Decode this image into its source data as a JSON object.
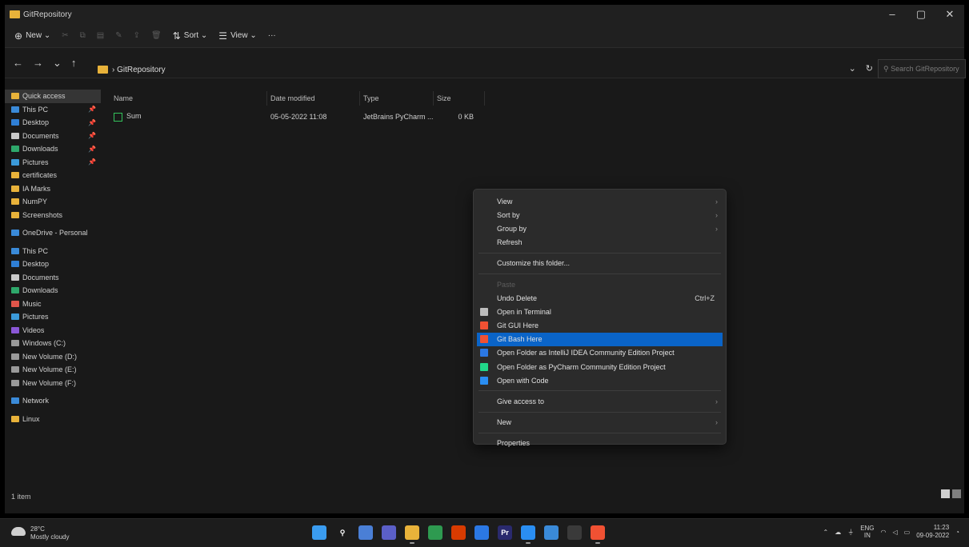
{
  "window": {
    "title": "GitRepository",
    "controls": [
      "–",
      "▢",
      "✕"
    ]
  },
  "commandbar": {
    "new_label": "New",
    "sort_label": "Sort",
    "view_label": "View",
    "more_label": "···"
  },
  "address": {
    "crumb": "GitRepository",
    "search_placeholder": "Search GitRepository"
  },
  "sidebar": {
    "items": [
      {
        "label": "Quick access",
        "color": "#e8b23a",
        "pinned": false,
        "active": true
      },
      {
        "label": "This PC",
        "color": "#3a8ad8",
        "pinned": true
      },
      {
        "label": "Desktop",
        "color": "#2f7fd6",
        "pinned": true
      },
      {
        "label": "Documents",
        "color": "#c9c9c9",
        "pinned": true
      },
      {
        "label": "Downloads",
        "color": "#2ea86b",
        "pinned": true
      },
      {
        "label": "Pictures",
        "color": "#3b9ad9",
        "pinned": true
      },
      {
        "label": "certificates",
        "color": "#e8b23a"
      },
      {
        "label": "IA Marks",
        "color": "#e8b23a"
      },
      {
        "label": "NumPY",
        "color": "#e8b23a"
      },
      {
        "label": "Screenshots",
        "color": "#e8b23a"
      },
      {
        "label": "OneDrive - Personal",
        "color": "#3a8ad8",
        "gap": true
      },
      {
        "label": "This PC",
        "color": "#3a8ad8",
        "gap": true
      },
      {
        "label": "Desktop",
        "color": "#2f7fd6"
      },
      {
        "label": "Documents",
        "color": "#c9c9c9"
      },
      {
        "label": "Downloads",
        "color": "#2ea86b"
      },
      {
        "label": "Music",
        "color": "#e0554a"
      },
      {
        "label": "Pictures",
        "color": "#3b9ad9"
      },
      {
        "label": "Videos",
        "color": "#8a57d6"
      },
      {
        "label": "Windows (C:)",
        "color": "#9a9a9a"
      },
      {
        "label": "New Volume (D:)",
        "color": "#9a9a9a"
      },
      {
        "label": "New Volume (E:)",
        "color": "#9a9a9a"
      },
      {
        "label": "New Volume (F:)",
        "color": "#9a9a9a"
      },
      {
        "label": "Network",
        "color": "#3a8ad8",
        "gap": true
      },
      {
        "label": "Linux",
        "color": "#e8b23a",
        "gap": true
      }
    ]
  },
  "file_list": {
    "columns": [
      "Name",
      "Date modified",
      "Type",
      "Size"
    ],
    "rows": [
      {
        "name": "Sum",
        "date": "05-05-2022 11:08",
        "type": "JetBrains PyCharm ...",
        "size": "0 KB"
      }
    ]
  },
  "status": {
    "count": "1 item"
  },
  "context_menu": {
    "items": [
      {
        "label": "View",
        "arrow": true
      },
      {
        "label": "Sort by",
        "arrow": true
      },
      {
        "label": "Group by",
        "arrow": true
      },
      {
        "label": "Refresh"
      },
      {
        "sep": true
      },
      {
        "label": "Customize this folder..."
      },
      {
        "sep": true
      },
      {
        "label": "Paste",
        "disabled": true
      },
      {
        "label": "Undo Delete",
        "shortcut": "Ctrl+Z"
      },
      {
        "label": "Open in Terminal",
        "icon_color": "#bdbdbd",
        "icon": "terminal-icon"
      },
      {
        "label": "Git GUI Here",
        "icon_color": "#f05133",
        "icon": "git-icon"
      },
      {
        "label": "Git Bash Here",
        "icon_color": "#f05133",
        "icon": "git-bash-icon",
        "highlight": true
      },
      {
        "label": "Open Folder as IntelliJ IDEA Community Edition Project",
        "icon_color": "#2b78e4",
        "icon": "intellij-icon"
      },
      {
        "label": "Open Folder as PyCharm Community Edition Project",
        "icon_color": "#21d789",
        "icon": "pycharm-icon"
      },
      {
        "label": "Open with Code",
        "icon_color": "#2a8ef2",
        "icon": "vscode-icon"
      },
      {
        "sep": true
      },
      {
        "label": "Give access to",
        "arrow": true
      },
      {
        "sep": true
      },
      {
        "label": "New",
        "arrow": true
      },
      {
        "sep": true
      },
      {
        "label": "Properties"
      }
    ]
  },
  "taskbar": {
    "weather_temp": "28°C",
    "weather_text": "Mostly cloudy",
    "apps": [
      {
        "name": "start-icon",
        "color": "#3a9cf0",
        "glyph": ""
      },
      {
        "name": "search-icon",
        "color": "transparent",
        "glyph": "⚲"
      },
      {
        "name": "task-view-icon",
        "color": "#4a7fd6",
        "glyph": ""
      },
      {
        "name": "chat-icon",
        "color": "#5b5fc7",
        "glyph": ""
      },
      {
        "name": "file-explorer-icon",
        "color": "#e8b23a",
        "glyph": "",
        "running": true
      },
      {
        "name": "chrome-icon",
        "color": "#2e9a50",
        "glyph": ""
      },
      {
        "name": "office-icon",
        "color": "#d83b01",
        "glyph": ""
      },
      {
        "name": "store-icon",
        "color": "#2b78e4",
        "glyph": ""
      },
      {
        "name": "premiere-icon",
        "color": "#2a2a6e",
        "glyph": "Pr"
      },
      {
        "name": "vscode-icon",
        "color": "#2a8ef2",
        "glyph": "",
        "running": true
      },
      {
        "name": "settings-icon",
        "color": "#3a8ad8",
        "glyph": ""
      },
      {
        "name": "terminal-icon",
        "color": "#3a3a3a",
        "glyph": ""
      },
      {
        "name": "git-icon",
        "color": "#f05133",
        "glyph": "",
        "running": true
      }
    ],
    "tray_lang_1": "ENG",
    "tray_lang_2": "IN",
    "time": "11:23",
    "date": "09-09-2022"
  }
}
